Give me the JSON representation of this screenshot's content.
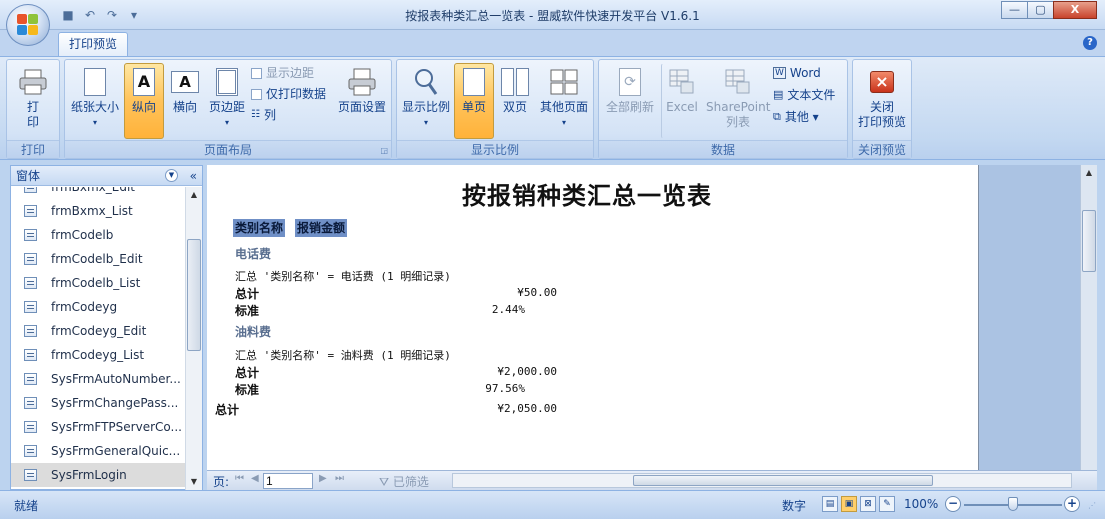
{
  "window": {
    "title": "按报表种类汇总一览表 - 盟威软件快速开发平台 V1.6.1",
    "controls": {
      "minimize": "▭",
      "maximize": "▢",
      "close": "X"
    }
  },
  "qat": {
    "save_icon": "save-icon",
    "undo_icon": "undo-icon",
    "redo_icon": "redo-icon"
  },
  "tabs": [
    {
      "label": "打印预览",
      "active": true
    }
  ],
  "help_icon": "?",
  "ribbon": {
    "groups": {
      "print": {
        "label": "打印",
        "print_label": "打\n印"
      },
      "layout": {
        "label": "页面布局",
        "paper_size": "纸张大小",
        "portrait": "纵向",
        "landscape": "横向",
        "margins": "页边距",
        "show_margins": "显示边距",
        "print_data_only": "仅打印数据",
        "columns": "列",
        "page_setup": "页面设置"
      },
      "zoom": {
        "label": "显示比例",
        "zoom": "显示比例",
        "one_page": "单页",
        "two_pages": "双页",
        "more_pages": "其他页面"
      },
      "data": {
        "label": "数据",
        "refresh_all": "全部刷新",
        "excel": "Excel",
        "sharepoint_line1": "SharePoint",
        "sharepoint_line2": "列表",
        "word": "Word",
        "text_file": "文本文件",
        "other": "其他 ▾"
      },
      "close": {
        "label": "关闭预览",
        "close_line1": "关闭",
        "close_line2": "打印预览",
        "close_glyph": "×"
      }
    }
  },
  "nav": {
    "header": "窗体",
    "collapse": "«",
    "items": [
      {
        "label": "frmBxmx_Edit",
        "partial": true
      },
      {
        "label": "frmBxmx_List"
      },
      {
        "label": "frmCodelb"
      },
      {
        "label": "frmCodelb_Edit"
      },
      {
        "label": "frmCodelb_List"
      },
      {
        "label": "frmCodeyg"
      },
      {
        "label": "frmCodeyg_Edit"
      },
      {
        "label": "frmCodeyg_List"
      },
      {
        "label": "SysFrmAutoNumber..."
      },
      {
        "label": "SysFrmChangePass..."
      },
      {
        "label": "SysFrmFTPServerCo..."
      },
      {
        "label": "SysFrmGeneralQuic..."
      },
      {
        "label": "SysFrmLogin",
        "selected": true
      }
    ]
  },
  "report": {
    "title": "按报销种类汇总一览表",
    "headers": {
      "category": "类别名称",
      "amount": "报销金额"
    },
    "groups": [
      {
        "name": "电话费",
        "summary": "汇总 '类别名称' =  电话费 (1 明细记录)",
        "total_label": "总计",
        "total": "¥50.00",
        "std_label": "标准",
        "std": "2.44%"
      },
      {
        "name": "油料费",
        "summary": "汇总 '类别名称' =  油料费 (1 明细记录)",
        "total_label": "总计",
        "total": "¥2,000.00",
        "std_label": "标准",
        "std": "97.56%"
      }
    ],
    "grand_total_label": "总计",
    "grand_total": "¥2,050.00"
  },
  "recordbar": {
    "page_label": "页:",
    "page_value": "1",
    "filter_label": "已筛选"
  },
  "status": {
    "ready": "就绪",
    "numlock": "数字",
    "zoom": "100%",
    "zoom_level": 0.5
  }
}
